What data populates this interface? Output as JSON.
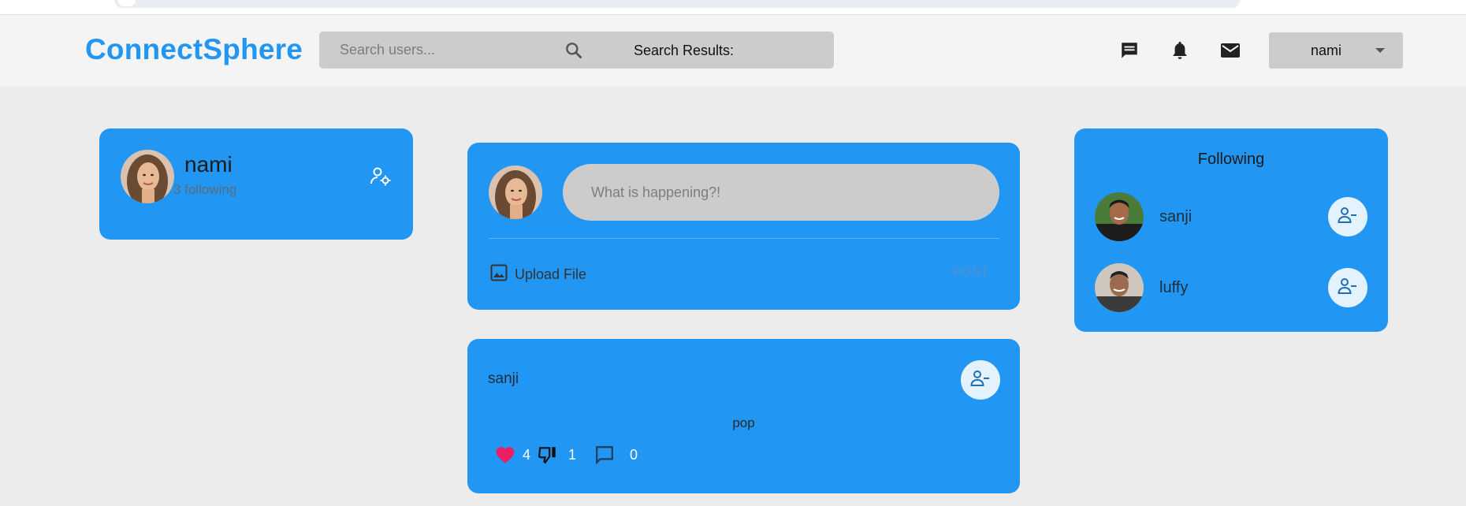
{
  "app": {
    "brand": "ConnectSphere"
  },
  "search": {
    "placeholder": "Search users...",
    "results_label": "Search Results:"
  },
  "header_icons": [
    "chat-icon",
    "bell-icon",
    "mail-icon"
  ],
  "user_menu": {
    "name": "nami"
  },
  "profile": {
    "name": "nami",
    "following_text": "3 following"
  },
  "compose": {
    "placeholder": "What is happening?!",
    "upload_label": "Upload File",
    "post_label": "POST"
  },
  "post": {
    "author": "sanji",
    "content": "pop",
    "likes": "4",
    "dislikes": "1",
    "comments": "0"
  },
  "following": {
    "title": "Following",
    "users": [
      {
        "name": "sanji"
      },
      {
        "name": "luffy"
      }
    ]
  },
  "colors": {
    "brand": "#2196f3",
    "card": "#2196f3",
    "like": "#e91e63",
    "background": "#ececec"
  }
}
